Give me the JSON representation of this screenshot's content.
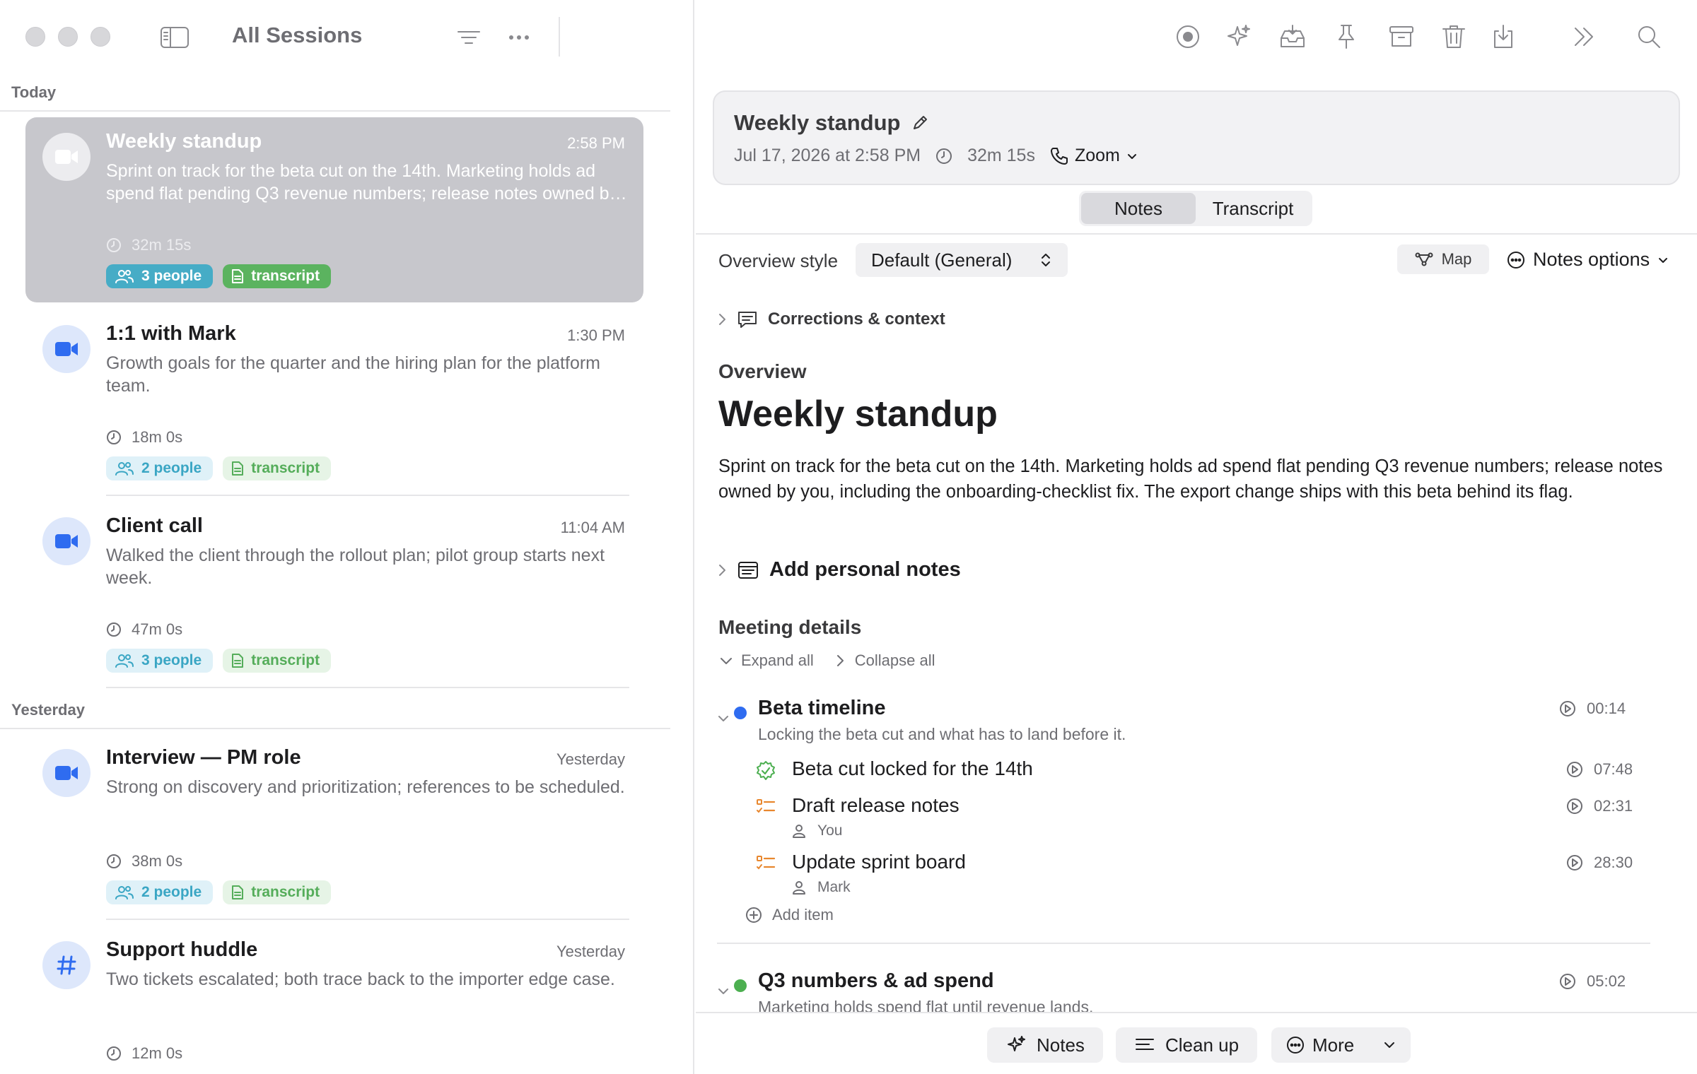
{
  "sidebar": {
    "title": "All Sessions",
    "sections": [
      {
        "label": "Today"
      },
      {
        "label": "Yesterday"
      }
    ],
    "sessions": [
      {
        "title": "Weekly standup",
        "time": "2:58 PM",
        "summary": "Sprint on track for the beta cut on the 14th. Marketing holds ad spend flat pending Q3 revenue numbers; release notes owned by you, including the onboarding-checklist fix. The export change ships with this beta behind its flag.",
        "duration": "32m 15s",
        "people": "3 people",
        "transcript": "transcript",
        "icon": "video-icon",
        "selected": true
      },
      {
        "title": "1:1 with Mark",
        "time": "1:30 PM",
        "summary": "Growth goals for the quarter and the hiring plan for the platform team.",
        "duration": "18m 0s",
        "people": "2 people",
        "transcript": "transcript",
        "icon": "video-icon"
      },
      {
        "title": "Client call",
        "time": "11:04 AM",
        "summary": "Walked the client through the rollout plan; pilot group starts next week.",
        "duration": "47m 0s",
        "people": "3 people",
        "transcript": "transcript",
        "icon": "video-icon"
      },
      {
        "title": "Interview — PM role",
        "time": "Yesterday",
        "summary": "Strong on discovery and prioritization; references to be scheduled.",
        "duration": "38m 0s",
        "people": "2 people",
        "transcript": "transcript",
        "icon": "video-icon"
      },
      {
        "title": "Support huddle",
        "time": "Yesterday",
        "summary": "Two tickets escalated; both trace back to the importer edge case.",
        "duration": "12m 0s",
        "people": "",
        "transcript": "",
        "icon": "hash-icon"
      }
    ]
  },
  "header": {
    "title": "Weekly standup",
    "date": "Jul 17, 2026 at 2:58 PM",
    "duration": "32m 15s",
    "platform": "Zoom"
  },
  "tabs": [
    {
      "label": "Notes",
      "active": true
    },
    {
      "label": "Transcript",
      "active": false
    }
  ],
  "options": {
    "overview_style_label": "Overview style",
    "overview_style_value": "Default (General)",
    "map_label": "Map",
    "notes_options_label": "Notes options"
  },
  "notes": {
    "corrections_label": "Corrections & context",
    "overview_heading": "Overview",
    "title": "Weekly standup",
    "body": "Sprint on track for the beta cut on the 14th. Marketing holds ad spend flat pending Q3 revenue numbers; release notes owned by you, including the onboarding-checklist fix. The export change ships with this beta behind its flag.",
    "personal_notes_label": "Add personal notes",
    "meeting_details_heading": "Meeting details",
    "expand_all": "Expand all",
    "collapse_all": "Collapse all",
    "add_item": "Add item",
    "topics": [
      {
        "title": "Beta timeline",
        "subtitle": "Locking the beta cut and what has to land before it.",
        "timestamp": "00:14",
        "color": "#2f6cf0",
        "items": [
          {
            "title": "Beta cut locked for the 14th",
            "timestamp": "07:48",
            "kind": "decision",
            "owner": ""
          },
          {
            "title": "Draft release notes",
            "timestamp": "02:31",
            "kind": "task",
            "owner": "You"
          },
          {
            "title": "Update sprint board",
            "timestamp": "28:30",
            "kind": "task",
            "owner": "Mark"
          }
        ]
      },
      {
        "title": "Q3 numbers & ad spend",
        "subtitle": "Marketing holds spend flat until revenue lands.",
        "timestamp": "05:02",
        "color": "#4caf50",
        "items": []
      }
    ]
  },
  "bottom_bar": {
    "notes_label": "Notes",
    "cleanup_label": "Clean up",
    "more_label": "More"
  },
  "colors": {
    "accent": "#2f6cf0",
    "people_tag": "#3aa6c4",
    "transcript_tag": "#55ad5a",
    "decision": "#4caf50",
    "task": "#e8872e"
  }
}
